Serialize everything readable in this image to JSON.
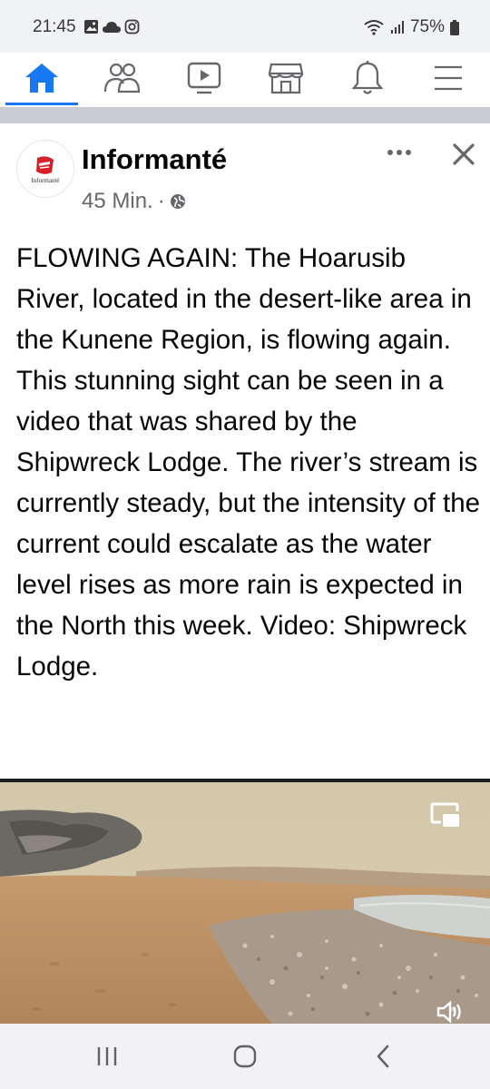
{
  "status_bar": {
    "time": "21:45",
    "battery": "75%",
    "icons": [
      "gallery-icon",
      "cloud-icon",
      "instagram-icon",
      "wifi-icon",
      "signal-icon",
      "battery-icon"
    ]
  },
  "nav": {
    "items": [
      "home-icon",
      "friends-icon",
      "watch-icon",
      "marketplace-icon",
      "notifications-icon",
      "menu-icon"
    ],
    "active": "home",
    "accent": "#1877f2"
  },
  "post": {
    "page_name": "Informanté",
    "avatar_text": "Informanté",
    "time": "45 Min.",
    "separator": "·",
    "text": "FLOWING AGAIN: The Hoarusib River, located in the desert-like area in the Kunene Region, is flowing again. This stunning sight can be seen in a video that was shared by the Shipwreck Lodge. The river’s stream is currently steady, but the intensity of the current could escalate as the water level rises as more rain is expected in the North this week. Video: Shipwreck Lodge."
  },
  "video": {
    "controls": [
      "picture-in-picture-icon",
      "volume-icon"
    ]
  },
  "android_nav": [
    "recents-icon",
    "home-icon",
    "back-icon"
  ]
}
